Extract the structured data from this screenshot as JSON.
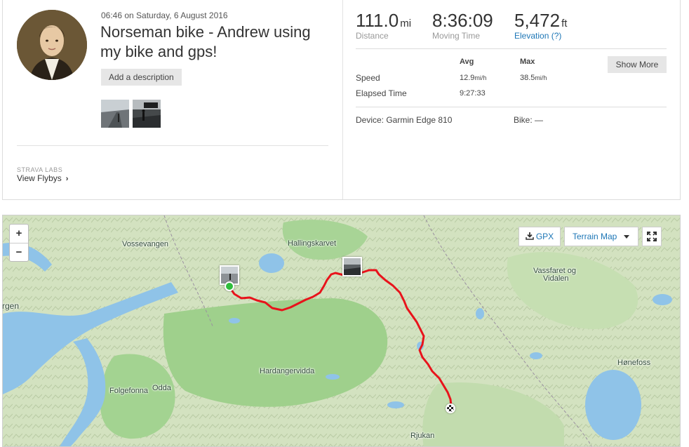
{
  "activity": {
    "timestamp": "06:46 on Saturday, 6 August 2016",
    "title": "Norseman bike - Andrew using my bike and gps!",
    "add_description": "Add a description"
  },
  "labs": {
    "tag": "STRAVA LABS",
    "flybys_link": "View Flybys"
  },
  "stats": {
    "distance": {
      "value": "111.0",
      "unit": "mi",
      "label": "Distance"
    },
    "moving_time": {
      "value": "8:36:09",
      "label": "Moving Time"
    },
    "elevation": {
      "value": "5,472",
      "unit": "ft",
      "label": "Elevation (?)"
    },
    "show_more": "Show More",
    "table_headers": [
      "Avg",
      "Max"
    ],
    "speed": {
      "label": "Speed",
      "avg": "12.9",
      "avg_unit": "mi/h",
      "max": "38.5",
      "max_unit": "mi/h"
    },
    "elapsed": {
      "label": "Elapsed Time",
      "avg": "9:27:33"
    },
    "device": "Device: Garmin Edge 810",
    "bike": "Bike: —"
  },
  "map": {
    "gpx": "GPX",
    "terrain": "Terrain Map",
    "zoom_in": "+",
    "zoom_out": "−",
    "labels": [
      "Vossevangen",
      "Hallingskarvet",
      "Vassfaret og",
      "Vidalen",
      "rgen",
      "Hardangervidda",
      "Folgefonna",
      "Odda",
      "Hønefoss",
      "Rjukan"
    ],
    "route_color": "#e8131b",
    "accent": "#1d76b6"
  }
}
